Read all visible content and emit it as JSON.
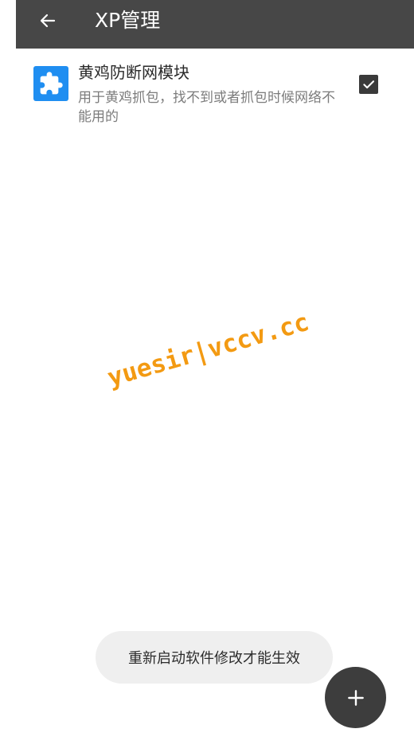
{
  "app_bar": {
    "title": "XP管理",
    "back_icon": "arrow-left-icon"
  },
  "modules": [
    {
      "title": "黄鸡防断网模块",
      "description": "用于黄鸡抓包，找不到或者抓包时候网络不能用的",
      "icon": "puzzle-icon",
      "enabled": true
    }
  ],
  "watermark": {
    "text": "yuesir|vccv.cc"
  },
  "toast": {
    "text": "重新启动软件修改才能生效"
  },
  "fab": {
    "icon": "plus-icon"
  },
  "colors": {
    "app_bar": "#474747",
    "accent_icon": "#1f8ef1",
    "checkbox": "#3a3a3a",
    "fab": "#3d3d3d",
    "watermark": "#f39a12"
  }
}
